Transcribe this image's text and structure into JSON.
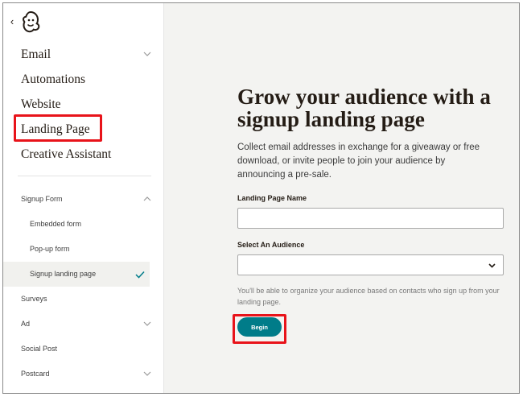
{
  "sidebar": {
    "main_items": [
      {
        "label": "Email",
        "has_chevron": true
      },
      {
        "label": "Automations",
        "has_chevron": false
      },
      {
        "label": "Website",
        "has_chevron": false
      },
      {
        "label": "Landing Page",
        "has_chevron": false,
        "highlighted": true
      },
      {
        "label": "Creative Assistant",
        "has_chevron": false
      }
    ],
    "sub_items": [
      {
        "label": "Signup Form",
        "chevron": "up"
      },
      {
        "label": "Embedded form",
        "child": true
      },
      {
        "label": "Pop-up form",
        "child": true
      },
      {
        "label": "Signup landing page",
        "child": true,
        "active": true,
        "checked": true
      },
      {
        "label": "Surveys"
      },
      {
        "label": "Ad",
        "chevron": "down"
      },
      {
        "label": "Social Post"
      },
      {
        "label": "Postcard",
        "chevron": "down"
      }
    ]
  },
  "main": {
    "headline": "Grow your audience with a signup landing page",
    "description": "Collect email addresses in exchange for a giveaway or free download, or invite people to join your audience by announcing a pre-sale.",
    "name_label": "Landing Page Name",
    "name_value": "",
    "audience_label": "Select An Audience",
    "audience_value": "",
    "help_text": "You'll be able to organize your audience based on contacts who sign up from your landing page.",
    "begin_label": "Begin"
  },
  "colors": {
    "accent": "#007c89",
    "highlight": "#e8131a",
    "main_bg": "#f3f3f1"
  }
}
